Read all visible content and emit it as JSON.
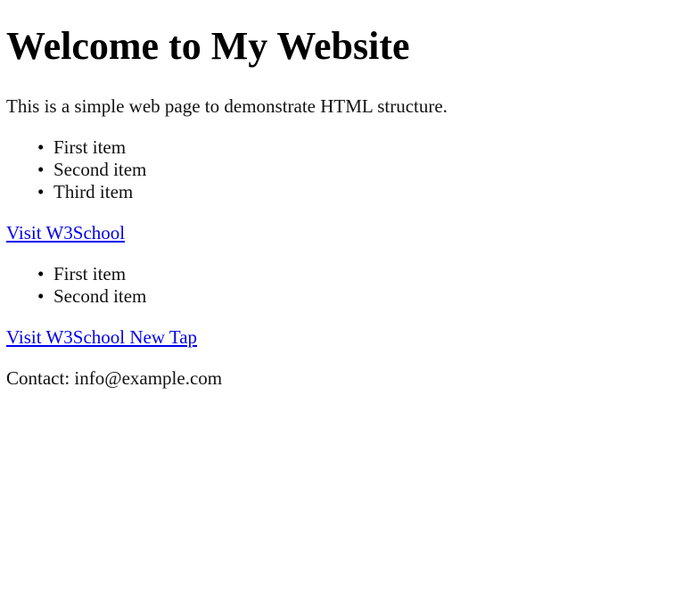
{
  "heading": "Welcome to My Website",
  "intro": "This is a simple web page to demonstrate HTML structure.",
  "list_one": [
    "First item",
    "Second item",
    "Third item"
  ],
  "link_one": "Visit W3School",
  "list_two": [
    "First item",
    "Second item"
  ],
  "link_two": "Visit W3School New Tap",
  "contact": "Contact: info@example.com",
  "colors": {
    "link": "#0000ee",
    "text": "#111111",
    "background": "#ffffff"
  }
}
